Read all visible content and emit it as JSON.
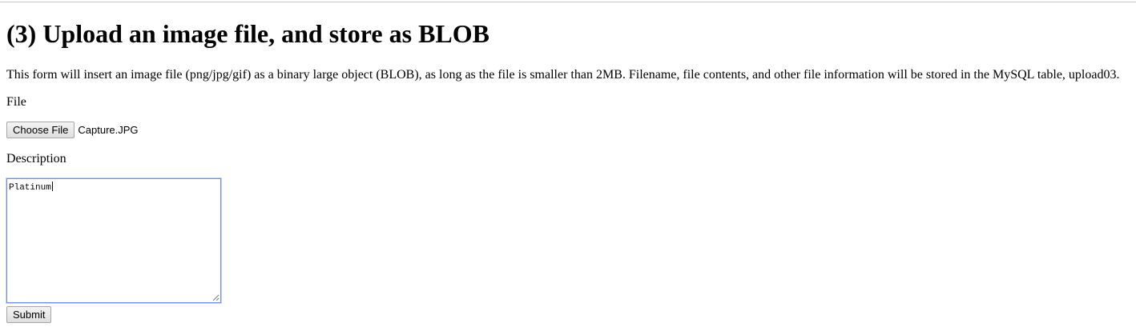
{
  "form": {
    "heading": "(3) Upload an image file, and store as BLOB",
    "intro": "This form will insert an image file (png/jpg/gif) as a binary large object (BLOB), as long as the file is smaller than 2MB. Filename, file contents, and other file information will be stored in the MySQL table, upload03.",
    "file_label": "File",
    "choose_file_label": "Choose File",
    "selected_file": "Capture.JPG",
    "description_label": "Description",
    "description_value": "Platinum",
    "submit_label": "Submit"
  },
  "colors": {
    "focus_border": "#6d8fe8",
    "button_border": "#a6a6a6",
    "top_rule": "#c8c8c8"
  }
}
